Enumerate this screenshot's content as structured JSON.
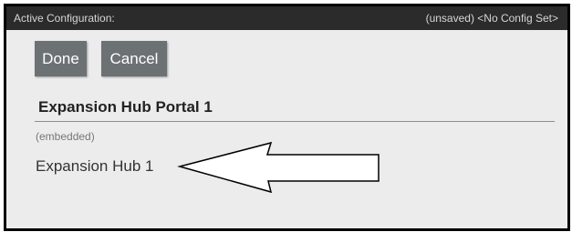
{
  "status_bar": {
    "title": "Active Configuration:",
    "config_status": "(unsaved) <No Config Set>"
  },
  "toolbar": {
    "done_label": "Done",
    "cancel_label": "Cancel"
  },
  "portal": {
    "name": "Expansion Hub Portal 1",
    "embedded_label": "(embedded)",
    "device_name": "Expansion Hub 1"
  },
  "colors": {
    "status_bar_bg": "#2b2b2b",
    "button_bg": "#6c7174",
    "field_underline": "#5aa0b0",
    "panel_bg": "#ececec"
  }
}
